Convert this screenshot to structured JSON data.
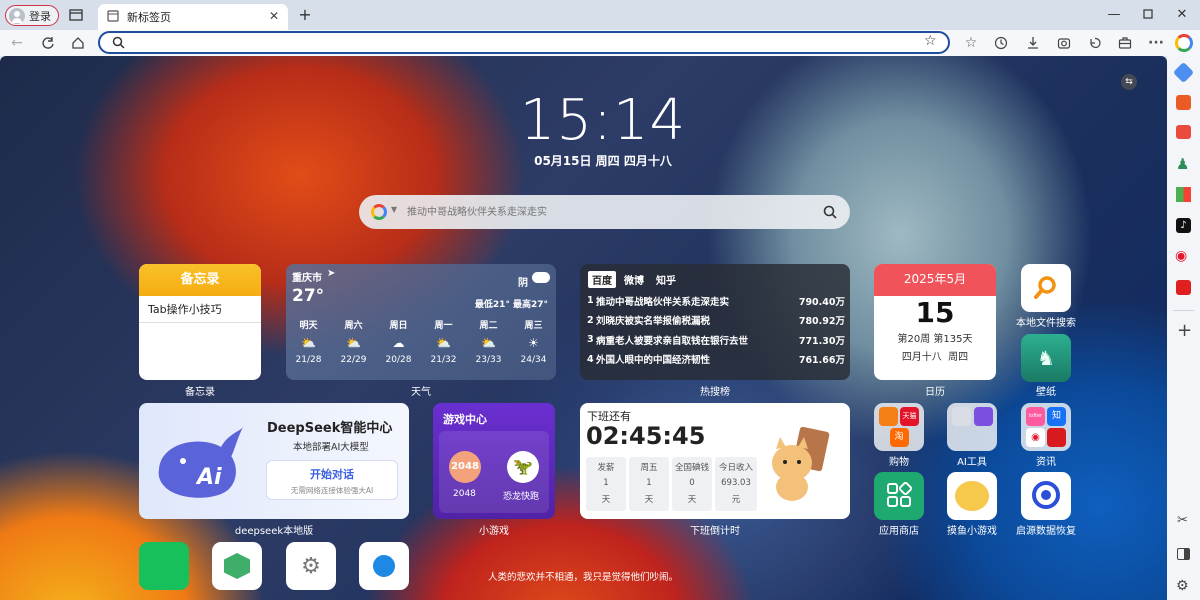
{
  "browser": {
    "login_label": "登录",
    "tab_title": "新标签页",
    "address_value": ""
  },
  "clock": {
    "time": "15:14",
    "date": "05月15日 周四 四月十八"
  },
  "search": {
    "placeholder": "推动中哥战略伙伴关系走深走实"
  },
  "memo": {
    "title": "备忘录",
    "item": "Tab操作小技巧",
    "caption": "备忘录"
  },
  "weather": {
    "city": "重庆市",
    "temp": "27°",
    "condition": "阴",
    "range": "最低21° 最高27°",
    "caption": "天气",
    "days": [
      {
        "name": "明天",
        "temp": "21/28"
      },
      {
        "name": "周六",
        "temp": "22/29"
      },
      {
        "name": "周日",
        "temp": "20/28"
      },
      {
        "name": "周一",
        "temp": "21/32"
      },
      {
        "name": "周二",
        "temp": "23/33"
      },
      {
        "name": "周三",
        "temp": "24/34"
      }
    ]
  },
  "hot": {
    "tabs": [
      "百度",
      "微博",
      "知乎"
    ],
    "caption": "热搜榜",
    "items": [
      {
        "rank": "1",
        "text": "推动中哥战略伙伴关系走深走实",
        "value": "790.40万"
      },
      {
        "rank": "2",
        "text": "刘晓庆被实名举报偷税漏税",
        "value": "780.92万"
      },
      {
        "rank": "3",
        "text": "病重老人被要求亲自取钱在银行去世",
        "value": "771.30万"
      },
      {
        "rank": "4",
        "text": "外国人眼中的中国经济韧性",
        "value": "761.66万"
      }
    ]
  },
  "calendar": {
    "month": "2025年5月",
    "day": "15",
    "week": "第20周 第135天",
    "lunar": "四月十八  周四",
    "caption": "日历"
  },
  "apps_top": [
    {
      "label": "本地文件搜索"
    },
    {
      "label": "壁纸"
    }
  ],
  "deepseek": {
    "title": "DeepSeek智能中心",
    "sub": "本地部署AI大模型",
    "btn": "开始对话",
    "btn_sub": "无需网络连接体验强大AI",
    "caption": "deepseek本地版",
    "logo_text": "Ai"
  },
  "games": {
    "title": "游戏中心",
    "g1": "2048",
    "g1_label": "2048",
    "g2_label": "恐龙快跑",
    "caption": "小游戏"
  },
  "countdown": {
    "title": "下班还有",
    "time": "02:45:45",
    "caption": "下班倒计时",
    "cols": [
      {
        "h": "发薪",
        "v": "1",
        "u": "天"
      },
      {
        "h": "周五",
        "v": "1",
        "u": "天"
      },
      {
        "h": "全国碘钱",
        "v": "0",
        "u": "天"
      },
      {
        "h": "今日收入",
        "v": "693.03",
        "u": "元"
      }
    ]
  },
  "apps_grid": [
    {
      "label": "购物"
    },
    {
      "label": "AI工具"
    },
    {
      "label": "资讯"
    },
    {
      "label": "应用商店"
    },
    {
      "label": "摸鱼小游戏"
    },
    {
      "label": "启源数据恢复"
    }
  ],
  "folder_labels": {
    "tmall": "天猫",
    "taobao": "淘",
    "zhi": "知",
    "lofter": "lofter"
  },
  "quote": "人类的悲欢并不相通，我只是觉得他们吵闹。"
}
